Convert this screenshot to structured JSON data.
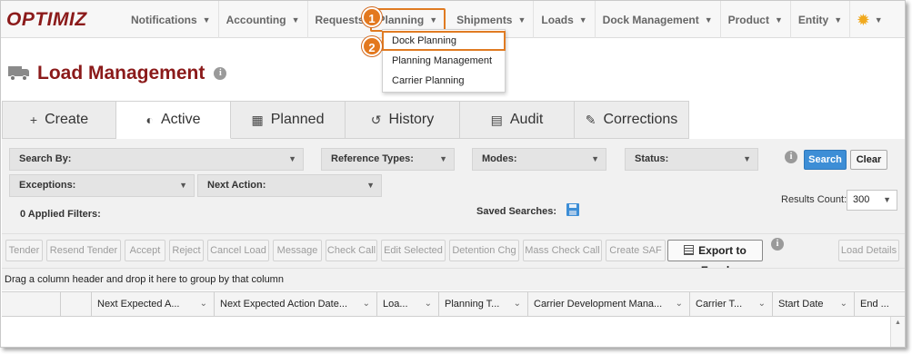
{
  "app": {
    "logo": "OPTIMIZ"
  },
  "nav": {
    "items": [
      {
        "label": "Notifications"
      },
      {
        "label": "Accounting"
      },
      {
        "label": "Requests"
      },
      {
        "label": "Planning"
      },
      {
        "label": "Shipments"
      },
      {
        "label": "Loads"
      },
      {
        "label": "Dock Management"
      },
      {
        "label": "Product"
      },
      {
        "label": "Entity"
      }
    ],
    "caret": "▼",
    "settings_icon": "gear-icon"
  },
  "callouts": [
    "1",
    "2"
  ],
  "planning_menu": {
    "items": [
      {
        "label": "Dock Planning"
      },
      {
        "label": "Planning Management"
      },
      {
        "label": "Carrier Planning"
      }
    ]
  },
  "page": {
    "title": "Load Management",
    "info": "i"
  },
  "tabs": [
    {
      "label": "Create",
      "icon": "+"
    },
    {
      "label": "Active",
      "icon": "◐"
    },
    {
      "label": "Planned",
      "icon": "▦"
    },
    {
      "label": "History",
      "icon": "↺"
    },
    {
      "label": "Audit",
      "icon": "▤"
    },
    {
      "label": "Corrections",
      "icon": "✎"
    }
  ],
  "filters": {
    "search_by": "Search By:",
    "reference_types": "Reference Types:",
    "modes": "Modes:",
    "status": "Status:",
    "exceptions": "Exceptions:",
    "next_action": "Next Action:",
    "applied": "0 Applied Filters:",
    "saved_searches": "Saved Searches:",
    "search_btn": "Search",
    "clear_btn": "Clear",
    "results_count_label": "Results Count:",
    "results_count_value": "300"
  },
  "toolbar": {
    "buttons": [
      "Tender",
      "Resend Tender",
      "Accept",
      "Reject",
      "Cancel Load",
      "Message",
      "Check Call",
      "Edit Selected",
      "Detention Chg",
      "Mass Check Call",
      "Create SAF"
    ],
    "export": "Export to Excel",
    "load_details": "Load Details"
  },
  "grid": {
    "group_hint": "Drag a column header and drop it here to group by that column",
    "columns": [
      "Next Expected A...",
      "Next Expected Action Date...",
      "Loa...",
      "Planning T...",
      "Carrier Development Mana...",
      "Carrier T...",
      "Start Date",
      "End ..."
    ]
  },
  "colors": {
    "accent": "#8b1a1a",
    "highlight": "#e07b22",
    "primary": "#3d8ed6"
  }
}
